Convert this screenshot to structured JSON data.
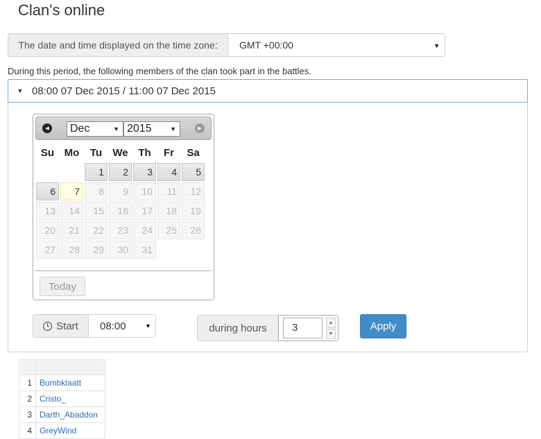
{
  "page": {
    "title": "Clan's online"
  },
  "timezone": {
    "label": "The date and time displayed on the time zone:",
    "value": "GMT +00:00"
  },
  "period": {
    "description": "During this period, the following members of the clan took part in the battles.",
    "range": "08:00 07 Dec 2015 / 11:00 07 Dec 2015"
  },
  "datepicker": {
    "month": "Dec",
    "year": "2015",
    "weekdays": [
      "Su",
      "Mo",
      "Tu",
      "We",
      "Th",
      "Fr",
      "Sa"
    ],
    "days": [
      "",
      "",
      "1",
      "2",
      "3",
      "4",
      "5",
      "6",
      "7",
      "8",
      "9",
      "10",
      "11",
      "12",
      "13",
      "14",
      "15",
      "16",
      "17",
      "18",
      "19",
      "20",
      "21",
      "22",
      "23",
      "24",
      "25",
      "26",
      "27",
      "28",
      "29",
      "30",
      "31"
    ],
    "today_day": "7",
    "active_days": [
      "1",
      "2",
      "3",
      "4",
      "5",
      "6"
    ],
    "today_label": "Today"
  },
  "start": {
    "label": "Start",
    "value": "08:00"
  },
  "hours": {
    "label": "during hours",
    "value": "3"
  },
  "apply_label": "Apply",
  "members": [
    {
      "num": "1",
      "name": "Bumbklaatt"
    },
    {
      "num": "2",
      "name": "Cristo_"
    },
    {
      "num": "3",
      "name": "Darth_Abaddon"
    },
    {
      "num": "4",
      "name": "GreyWind"
    }
  ],
  "colors": {
    "accent": "#428bca",
    "link": "#2a6ebb",
    "focus_border": "#66afe9"
  }
}
